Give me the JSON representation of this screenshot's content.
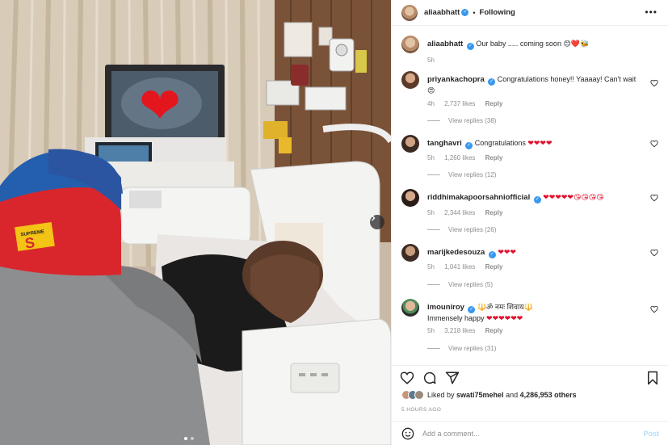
{
  "post": {
    "username": "aliaabhatt",
    "following_label": "Following",
    "more_label": "•••",
    "caption": {
      "text": "Our baby ..... coming soon ",
      "emojis": "😊❤️🐝",
      "time": "5h"
    },
    "media": {
      "heart_emoji": "❤",
      "cap_text": "SUPREME",
      "cap_letter": "S",
      "carousel_count": 2,
      "carousel_active": 1
    }
  },
  "comments": [
    {
      "username": "priyankachopra",
      "text": "Congratulations honey!! Yaaaay! Can't wait",
      "emojis": "😍",
      "time": "4h",
      "likes": "2,737 likes",
      "reply": "Reply",
      "view_replies": "View replies (38)"
    },
    {
      "username": "tanghavri",
      "text": "Congratulations ",
      "emojis": "❤❤❤❤",
      "time": "5h",
      "likes": "1,260 likes",
      "reply": "Reply",
      "view_replies": "View replies (12)"
    },
    {
      "username": "riddhimakapoorsahniofficial",
      "text": "",
      "emojis": "❤❤❤❤❤😘😘😘😘",
      "time": "5h",
      "likes": "2,344 likes",
      "reply": "Reply",
      "view_replies": "View replies (26)"
    },
    {
      "username": "marijkedesouza",
      "text": "",
      "emojis": "❤❤❤",
      "time": "5h",
      "likes": "1,041 likes",
      "reply": "Reply",
      "view_replies": "View replies (5)"
    },
    {
      "username": "imouniroy",
      "text": "🔱ॐ नमः शिवाय🔱",
      "text2": "Immensely happy ",
      "emojis": "❤❤❤❤❤❤",
      "time": "5h",
      "likes": "3,218 likes",
      "reply": "Reply",
      "view_replies": "View replies (31)"
    }
  ],
  "likes": {
    "prefix": "Liked by ",
    "liked_by_user": "swati75mehel",
    "middle": " and ",
    "count": "4,286,953 others"
  },
  "time_ago": "5 HOURS AGO",
  "add_comment": {
    "placeholder": "Add a comment...",
    "post_label": "Post"
  },
  "colors": {
    "verified": "#3897f0",
    "heart": "#e0102d",
    "muted_text": "#8e8e8e",
    "post_button": "#b2dffc"
  },
  "icons": [
    "more-icon",
    "heart-icon",
    "comment-icon",
    "share-icon",
    "bookmark-icon",
    "emoji-icon",
    "chevron-right-icon",
    "verified-icon"
  ]
}
